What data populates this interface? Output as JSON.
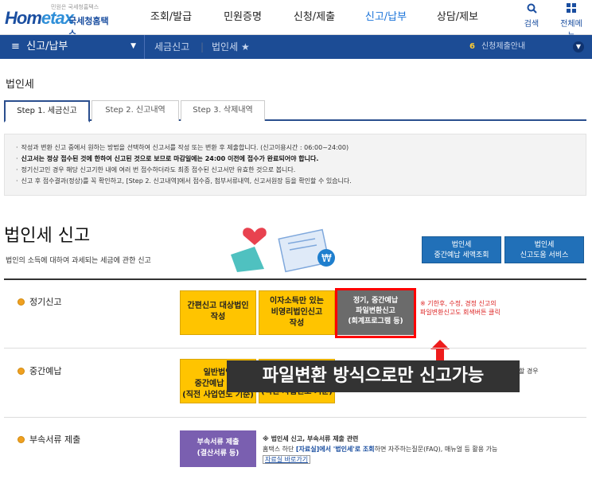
{
  "logo": {
    "small": "민원은 국세청홈택스",
    "brand_a": "Hom",
    "brand_b": "etax",
    "sub": "국세청홈택스"
  },
  "gnb": [
    "조회/발급",
    "민원증명",
    "신청/제출",
    "신고/납부",
    "상담/제보"
  ],
  "gnb_active": 3,
  "top_icons": [
    {
      "icon": "search-icon",
      "label": "검색"
    },
    {
      "icon": "grid-menu-icon",
      "label": "전체메뉴"
    }
  ],
  "subbar": {
    "menu": "신고/납부",
    "crumb1": "세금신고",
    "crumb2": "법인세",
    "guide_num": "6",
    "guide_text": "신청제출안내"
  },
  "page_title": "법인세",
  "tabs": [
    "Step 1. 세금신고",
    "Step 2. 신고내역",
    "Step 3. 삭제내역"
  ],
  "notice": [
    "작성과 변환 신고 중에서 원하는 방법을 선택하여 신고서를 작성 또는 변환 후 제출합니다. (신고이용시간 : 06:00~24:00)",
    "신고서는 정상 접수된 것에 한하여 신고된 것으로 보므로 마감일에는 24:00 이전에 접수가 완료되어야 합니다.",
    "정기신고인 경우 해당 신고기한 내에 여러 번 접수하더라도 최종 접수된 신고서만 유효한 것으로 봅니다.",
    "신고 후 접수결과(정상)를 꼭 확인하고, [Step 2. 신고내역]에서 접수증, 첨부서류내역, 신고서원장 등을 확인할 수 있습니다."
  ],
  "section": {
    "title": "법인세 신고",
    "desc": "법인의 소득에 대하여 과세되는 세금에 관한 신고"
  },
  "blue_buttons": [
    {
      "line1": "법인세",
      "line2": "중간예납 세액조회"
    },
    {
      "line1": "법인세",
      "line2": "신고도움 서비스"
    }
  ],
  "rows": {
    "regular": {
      "label": "정기신고",
      "btn1": [
        "간편신고 대상법인",
        "작성"
      ],
      "btn2": [
        "이자소득만 있는",
        "비영리법인신고",
        "작성"
      ],
      "btn3": [
        "정기, 중간예납",
        "파일변환신고",
        "(회계프로그램 등)"
      ],
      "note": [
        "※ 기한후, 수정, 경정 신고의",
        "파일변환신고도 회색버튼 클릭"
      ]
    },
    "interim": {
      "label": "중간예납",
      "btn1": [
        "일반법인",
        "중간예납 신고",
        "(직전 사업연도 기준)"
      ],
      "btn2": [
        "(직전 사업연도 기준)"
      ],
      "side": "으로 신고할 경우"
    },
    "attach": {
      "label": "부속서류 제출",
      "btn": [
        "부속서류 제출",
        "(결산서류 등)"
      ],
      "note1": "※ 법인세 신고, 부속서류 제출 관련",
      "note2_a": "홈택스 하단 ",
      "note2_b": "[자료실]에서 '법인세'로 조회",
      "note2_c": "하면 자주하는질문(FAQ), 매뉴얼 등 활용 가능",
      "link": "자료실 바로가기"
    }
  },
  "overlay": "파일변환 방식으로만 신고가능"
}
